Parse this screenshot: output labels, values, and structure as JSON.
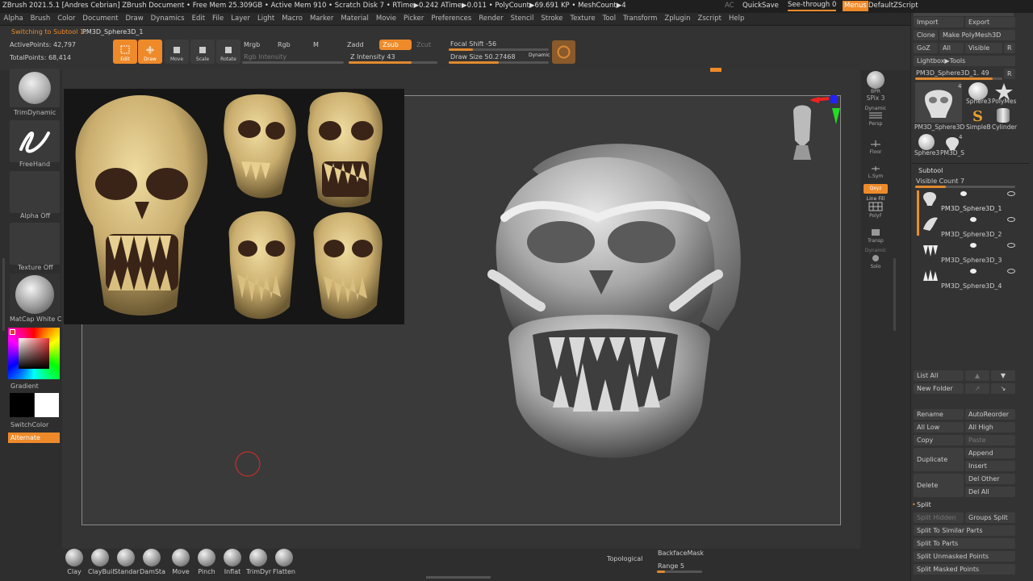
{
  "titlebar": {
    "text": "ZBrush 2021.5.1 [Andres Cebrian]   ZBrush Document     • Free Mem 25.309GB • Active Mem 910 • Scratch Disk 7 • RTime▶0.242 ATime▶0.011 • PolyCount▶69.691 KP • MeshCount▶4",
    "ac": "AC",
    "quicksave": "QuickSave",
    "seethrough": "See-through  0",
    "menus": "Menus",
    "script": "DefaultZScript"
  },
  "menubar": [
    "Alpha",
    "Brush",
    "Color",
    "Document",
    "Draw",
    "Dynamics",
    "Edit",
    "File",
    "Layer",
    "Light",
    "Macro",
    "Marker",
    "Material",
    "Movie",
    "Picker",
    "Preferences",
    "Render",
    "Stencil",
    "Stroke",
    "Texture",
    "Tool",
    "Transform",
    "Zplugin",
    "Zscript",
    "Help"
  ],
  "toolbar": {
    "status": "Switching to Subtool 1:",
    "status_tool": "PM3D_Sphere3D_1",
    "active_points": "ActivePoints: 42,797",
    "total_points": "TotalPoints: 68,414",
    "edit": "Edit",
    "draw": "Draw",
    "move": "Move",
    "scale": "Scale",
    "rotate": "Rotate",
    "mrgb": "Mrgb",
    "rgb": "Rgb",
    "m": "M",
    "rgb_intensity": "Rgb Intensity",
    "zadd": "Zadd",
    "zsub": "Zsub",
    "zcut": "Zcut",
    "z_intensity": "Z Intensity 43",
    "focal_shift": "Focal Shift -56",
    "draw_size": "Draw Size 50.27468",
    "dynamic": "Dynamic"
  },
  "lefttray": {
    "brush": "TrimDynamic",
    "stroke": "FreeHand",
    "alpha": "Alpha Off",
    "texture": "Texture Off",
    "material": "MatCap White C",
    "gradient": "Gradient",
    "switchcolor": "SwitchColor",
    "alternate": "Alternate"
  },
  "righttray": {
    "bpr": "BPR",
    "spix": "SPix 3",
    "dynamic": "Dynamic",
    "persp": "Persp",
    "floor": "Floor",
    "lsym": "L.Sym",
    "qxyz": "Qxyz",
    "linefill": "Line Fill",
    "polyf": "PolyF",
    "transp": "Transp",
    "dynamic2": "Dynamic",
    "solo": "Solo"
  },
  "panel": {
    "import": "Import",
    "export": "Export",
    "clone": "Clone",
    "make_polymesh": "Make PolyMesh3D",
    "goz": "GoZ",
    "all": "All",
    "visible": "Visible",
    "r": "R",
    "lightbox_tools": "Lightbox▶Tools",
    "current_tool": "PM3D_Sphere3D_1. 49",
    "r2": "R",
    "tool_thumbs": [
      "PM3D_Sphere3D",
      "Sphere3",
      "PolyMes",
      "SimpleB",
      "Cylinder",
      "Sphere3",
      "PM3D_S"
    ],
    "count_4a": "4",
    "count_4b": "4",
    "subtool": "Subtool",
    "visible_count": "Visible Count 7",
    "subtools": [
      "PM3D_Sphere3D_1",
      "PM3D_Sphere3D_2",
      "PM3D_Sphere3D_3",
      "PM3D_Sphere3D_4"
    ],
    "list_all": "List All",
    "new_folder": "New Folder",
    "rename": "Rename",
    "autoreorder": "AutoReorder",
    "all_low": "All Low",
    "all_high": "All High",
    "copy": "Copy",
    "paste": "Paste",
    "duplicate": "Duplicate",
    "append": "Append",
    "insert": "Insert",
    "delete": "Delete",
    "del_other": "Del Other",
    "del_all": "Del All",
    "split": "Split",
    "split_hidden": "Split Hidden",
    "groups_split": "Groups Split",
    "split_similar": "Split To Similar Parts",
    "split_parts": "Split To Parts",
    "split_unmasked": "Split Unmasked Points",
    "split_masked": "Split Masked Points"
  },
  "bottom": {
    "brushes": [
      "Clay",
      "ClayBuil",
      "Standar",
      "DamSta",
      "Move",
      "Pinch",
      "Inflat",
      "TrimDyr",
      "Flatten"
    ],
    "topological": "Topological",
    "backfacemask": "BackfaceMask",
    "range": "Range 5"
  },
  "colors": {
    "accent": "#ee8a2a",
    "bone": "#d4b97a"
  }
}
